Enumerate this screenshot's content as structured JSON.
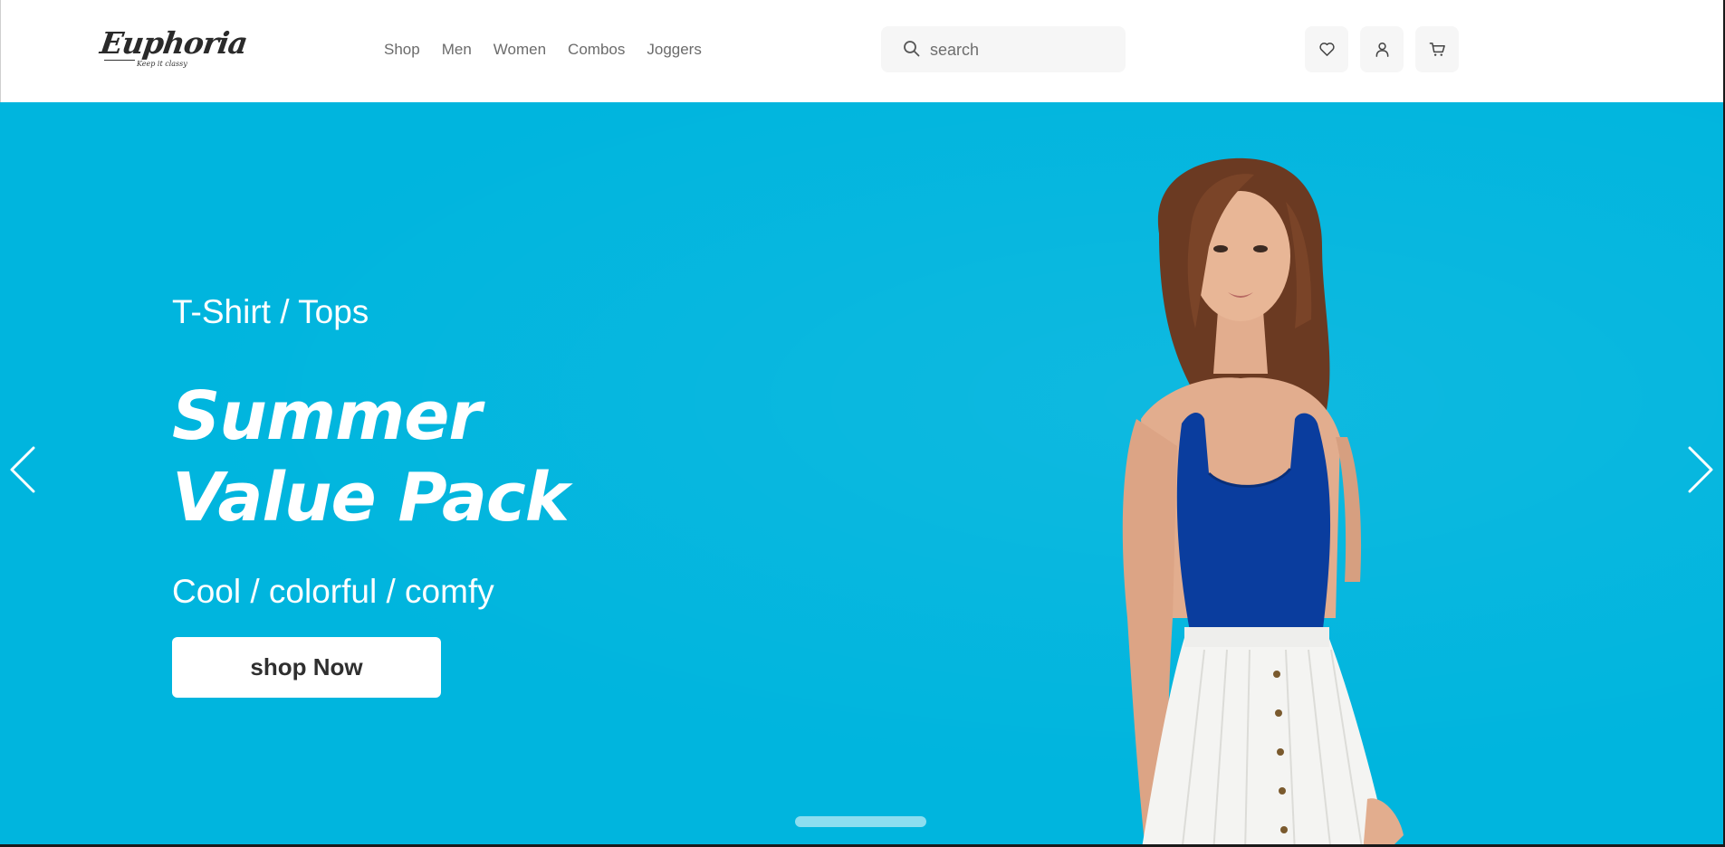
{
  "brand": {
    "name": "Euphoria",
    "tagline": "Keep it classy"
  },
  "nav": {
    "items": [
      "Shop",
      "Men",
      "Women",
      "Combos",
      "Joggers"
    ]
  },
  "search": {
    "placeholder": "search",
    "value": "",
    "icon": "search-icon"
  },
  "header_actions": {
    "icons": [
      "heart-icon",
      "user-icon",
      "cart-icon"
    ]
  },
  "hero": {
    "eyebrow": "T-Shirt / Tops",
    "headline_line1": "Summer",
    "headline_line2": "Value Pack",
    "subline": "Cool / colorful / comfy",
    "cta_label": "shop Now",
    "background_color": "#00b5de",
    "prev_icon": "chevron-left-icon",
    "next_icon": "chevron-right-icon",
    "slide_indicator_count": 1
  },
  "colors": {
    "accent": "#00b5de",
    "nav_text": "#6b6b6b",
    "button_bg": "#ffffff",
    "icon_bg": "#f6f6f6"
  }
}
